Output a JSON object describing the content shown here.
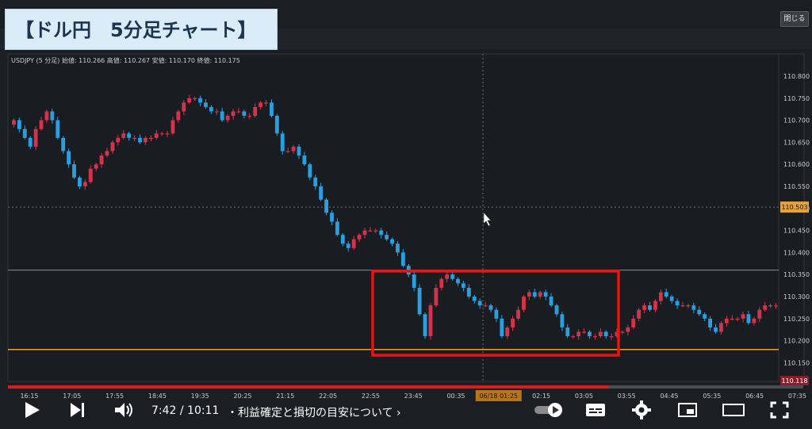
{
  "title_banner": "【ドル円　5分足チャート】",
  "close_button": "閉じる",
  "symbol_info": "USDJPY (5 分足) 始値: 110.266 高値: 110.267 安値: 110.170 終値: 110.175",
  "colors": {
    "up": "#d6334a",
    "down": "#2a9fe0",
    "orange_line": "#e8a23a",
    "highlight_box": "#ee1111",
    "background": "#1b1e23"
  },
  "chart_data": {
    "type": "candlestick",
    "x_labels": [
      "16:15",
      "17:05",
      "17:55",
      "18:45",
      "19:35",
      "20:25",
      "21:15",
      "22:05",
      "22:55",
      "23:45",
      "00:35",
      "06/18 01:25",
      "02:15",
      "03:05",
      "03:55",
      "04:45",
      "05:35",
      "06:45",
      "07:35"
    ],
    "y_ticks": [
      "110.800",
      "110.750",
      "110.700",
      "110.650",
      "110.600",
      "110.550",
      "110.500",
      "110.450",
      "110.400",
      "110.350",
      "110.300",
      "110.250",
      "110.200",
      "110.150"
    ],
    "ylim": [
      110.118,
      110.828
    ],
    "crosshair_price": "110.503",
    "last_price": "110.118",
    "close_series": [
      110.7,
      110.68,
      110.66,
      110.64,
      110.68,
      110.7,
      110.72,
      110.7,
      110.66,
      110.63,
      110.6,
      110.57,
      110.55,
      110.56,
      110.59,
      110.6,
      110.62,
      110.63,
      110.65,
      110.66,
      110.67,
      110.66,
      110.66,
      110.65,
      110.66,
      110.66,
      110.67,
      110.67,
      110.67,
      110.7,
      110.72,
      110.74,
      110.75,
      110.75,
      110.74,
      110.73,
      110.72,
      110.72,
      110.7,
      110.71,
      110.72,
      110.72,
      110.71,
      110.71,
      110.73,
      110.74,
      110.74,
      110.71,
      110.67,
      110.63,
      110.63,
      110.64,
      110.62,
      110.6,
      110.57,
      110.55,
      110.52,
      110.49,
      110.47,
      110.44,
      110.42,
      110.41,
      110.43,
      110.44,
      110.45,
      110.45,
      110.45,
      110.44,
      110.43,
      110.42,
      110.4,
      110.37,
      110.35,
      110.32,
      110.26,
      110.21,
      110.28,
      110.32,
      110.34,
      110.35,
      110.34,
      110.33,
      110.32,
      110.3,
      110.29,
      110.28,
      110.28,
      110.27,
      110.25,
      110.21,
      110.23,
      110.25,
      110.27,
      110.3,
      110.31,
      110.3,
      110.31,
      110.3,
      110.28,
      110.26,
      110.23,
      110.21,
      110.21,
      110.22,
      110.22,
      110.21,
      110.21,
      110.22,
      110.21,
      110.21,
      110.22,
      110.22,
      110.23,
      110.25,
      110.27,
      110.28,
      110.27,
      110.29,
      110.31,
      110.3,
      110.29,
      110.28,
      110.28,
      110.28,
      110.27,
      110.26,
      110.25,
      110.23,
      110.22,
      110.24,
      110.25,
      110.25,
      110.25,
      110.26,
      110.24,
      110.25,
      110.27,
      110.28,
      110.28,
      110.28
    ]
  },
  "player": {
    "current_time": "7:42 / 10:11",
    "chapter": "・利益確定と損切の目安について ›",
    "played_fraction": 0.756
  }
}
